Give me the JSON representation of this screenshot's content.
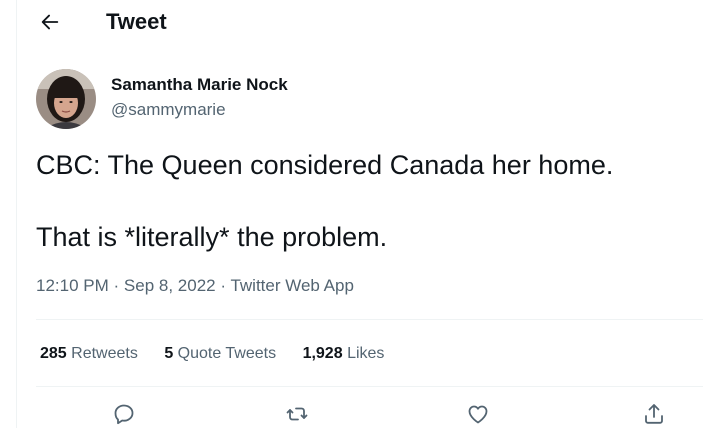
{
  "header": {
    "title": "Tweet"
  },
  "tweet": {
    "author": {
      "name": "Samantha Marie Nock",
      "handle": "@sammymarie"
    },
    "text_lines": [
      "CBC: The Queen considered Canada her home.",
      "That is *literally* the problem."
    ],
    "time": "12:10 PM",
    "date": "Sep 8, 2022",
    "source": "Twitter Web App",
    "separator": "·",
    "stats": {
      "retweets_count": "285",
      "retweets_label": "Retweets",
      "quotes_count": "5",
      "quotes_label": "Quote Tweets",
      "likes_count": "1,928",
      "likes_label": "Likes"
    }
  },
  "icons": {
    "back": "arrow-left-icon",
    "reply": "reply-icon",
    "retweet": "retweet-icon",
    "like": "heart-icon",
    "share": "share-icon"
  },
  "colors": {
    "text": "#0f1419",
    "secondary": "#536471",
    "divider": "#eff3f4"
  }
}
